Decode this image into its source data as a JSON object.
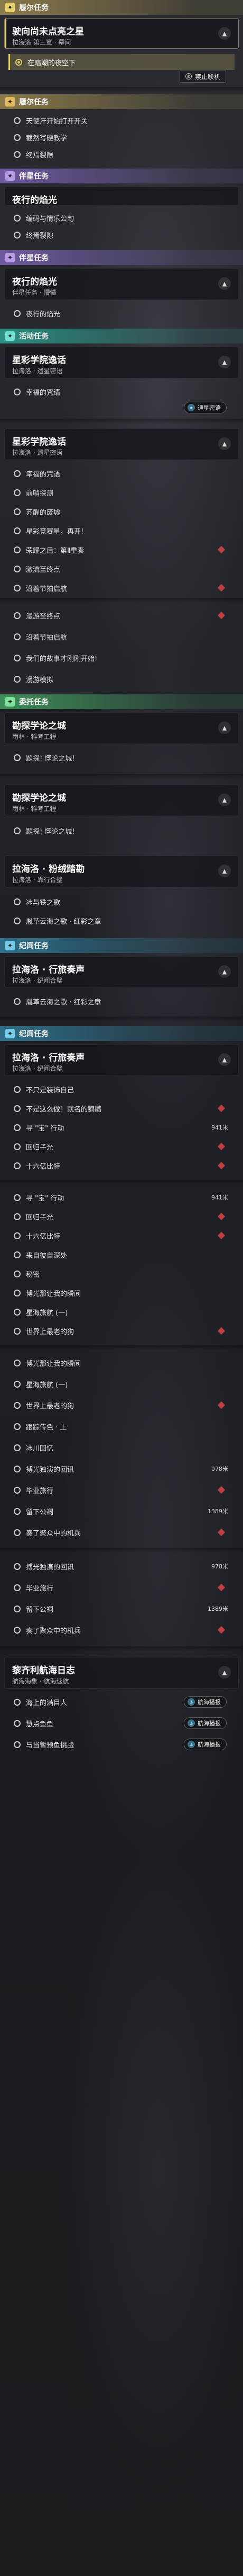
{
  "colors": {
    "main": "#e5cf6a",
    "companion": "#b49ae6",
    "event": "#6fe0cf",
    "daily": "#7fe19a",
    "memory": "#76c9e6",
    "alert": "#d94545"
  },
  "sec1": {
    "header": "履尔任务",
    "title": "驶向尚未点亮之星",
    "sub": "拉海洛 第三章 · 幕间",
    "sel_item": "在暗潮的夜空下",
    "btn": "禁止联机"
  },
  "sec2": {
    "header": "履尔任务",
    "items": [
      "天使汗开始打开开关",
      "截然写硬教学",
      "终焉裂隙"
    ]
  },
  "sec3": {
    "header": "伴星任务",
    "title": "夜行的焰光",
    "items": [
      "编码与情乐公旬",
      "终焉裂隙"
    ]
  },
  "sec4": {
    "header": "伴星任务",
    "title": "夜行的焰光",
    "sub": "伴星任务 · 懵懂",
    "items": [
      "夜行的焰光"
    ]
  },
  "sec5": {
    "header": "活动任务",
    "title": "星彩学院逸话",
    "sub": "拉海洛 · 遗星密语",
    "items": [
      "幸福的咒语"
    ],
    "pill": "通星密语"
  },
  "sec6": {
    "title": "星彩学院逸话",
    "sub": "拉海洛 · 遗星密语",
    "items": [
      "幸福的咒语",
      "前哨探测",
      "苏醒的废墟",
      "星彩竞赛星，再开!",
      "荣耀之后：第Ⅱ重奏",
      "激流至终点",
      "沿着节拍启航",
      "漫游至终点",
      "沿着节拍启航",
      "我们的故事才刚刚开始!",
      "漫游模拟"
    ]
  },
  "sec7": {
    "header": "委托任务",
    "title": "勘探学论之城",
    "sub": "雨林 · 科考工程",
    "items": [
      "题探! 悖论之城!"
    ]
  },
  "sec8": {
    "title": "勘探学论之城",
    "sub": "雨林 · 科考工程",
    "items": [
      "题探! 悖论之城!"
    ]
  },
  "sec9": {
    "title": "拉海洛 · 粉绒踏勘",
    "sub": "拉海洛 · 靠行合璧",
    "items": [
      "冰与铁之歌",
      "胤革云海之歌 · 红彩之章"
    ]
  },
  "sec10": {
    "header": "纪闻任务",
    "title": "拉海洛 · 行旅奏声",
    "sub": "拉海洛 · 纪闻合璧",
    "items": [
      "胤革云海之歌 · 红彩之章"
    ]
  },
  "sec11": {
    "header": "纪闻任务",
    "title": "拉海洛 · 行旅奏声",
    "sub": "拉海洛 · 纪闻合璧",
    "items": [
      "不只是装饰自己",
      "不是这么做！就名的鹦鹉",
      "寻 \"宝\" 行动",
      "回归子光",
      "十六亿比特"
    ],
    "item2_tag": "941米"
  },
  "sec12": {
    "items": [
      "寻 \"宝\" 行动",
      "回归子光",
      "十六亿比特",
      "来自彼自深处",
      "秘密",
      "博光那让我的瞬间",
      "星海旅航 (一)",
      "世界上最老的狗"
    ],
    "item0_tag": "941米"
  },
  "sec13": {
    "items": [
      "博光那让我的瞬间",
      "星海旅航 (一)",
      "世界上最老的狗",
      "跟踪传色 · 上",
      "冰川回忆",
      "搏光独演的回讯",
      "毕业旅行",
      "留下公祠",
      "奏了聚众中的机兵"
    ],
    "item5_tag": "978米",
    "item7_tag": "1389米"
  },
  "sec14": {
    "items": [
      "搏光独演的回讯",
      "毕业旅行",
      "留下公祠",
      "奏了聚众中的机兵"
    ],
    "item0_tag": "978米",
    "item2_tag": "1389米"
  },
  "sec15": {
    "title": "黎齐利航海日志",
    "sub": "航海海象 · 航海速航",
    "items": [
      "海上的满目人",
      "慧点鱼鱼",
      "与当暂预鱼挑战"
    ],
    "pill": "航海播报"
  }
}
